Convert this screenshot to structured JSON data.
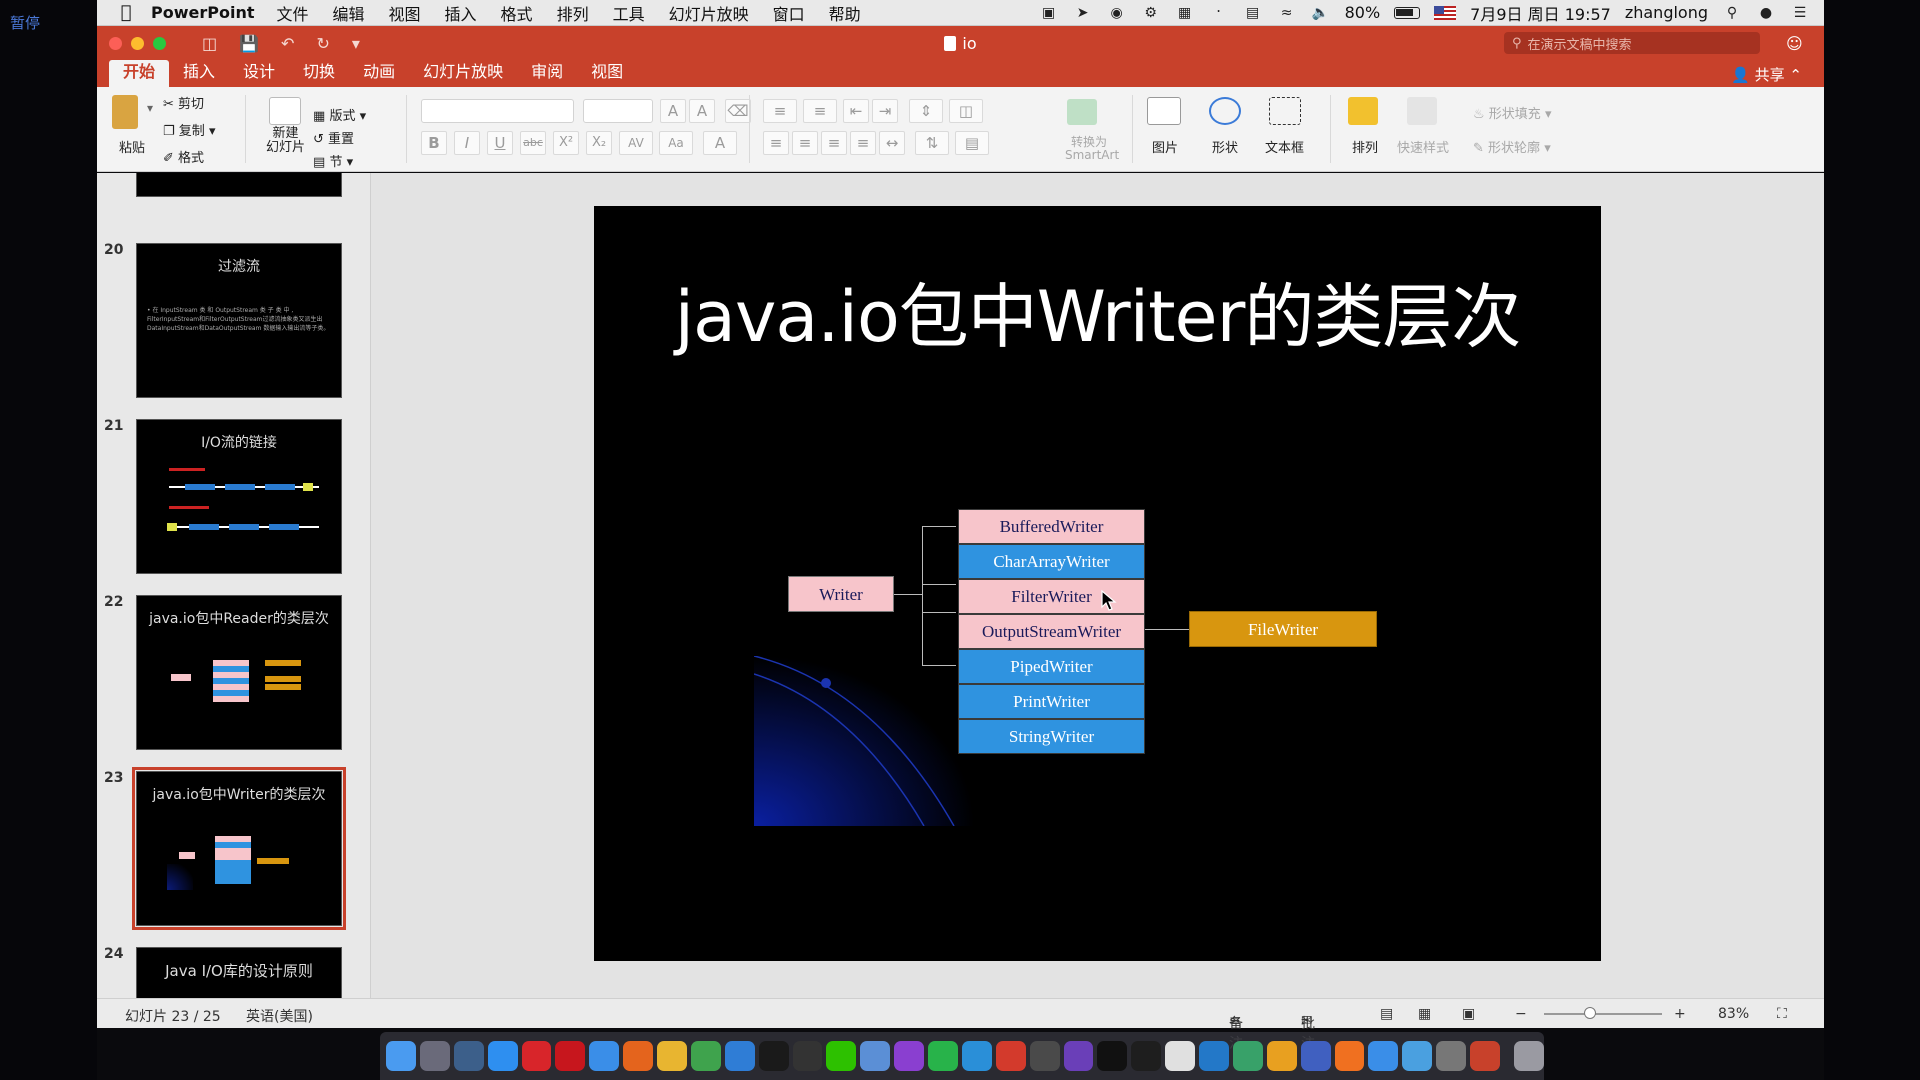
{
  "desktop": {
    "pause_label": "暂停"
  },
  "menubar": {
    "app": "PowerPoint",
    "items": [
      "文件",
      "编辑",
      "视图",
      "插入",
      "格式",
      "排列",
      "工具",
      "幻灯片放映",
      "窗口",
      "帮助"
    ],
    "battery": "80%",
    "datetime": "7月9日 周日 19:57",
    "user": "zhanglong"
  },
  "window": {
    "title": "io",
    "search_placeholder": "在演示文稿中搜索"
  },
  "ribbon_tabs": [
    "开始",
    "插入",
    "设计",
    "切换",
    "动画",
    "幻灯片放映",
    "审阅",
    "视图"
  ],
  "share_label": "共享",
  "ribbon": {
    "paste": "粘贴",
    "cut": "剪切",
    "copy": "复制",
    "format": "格式",
    "new_slide": "新建\n幻灯片",
    "layout": "版式",
    "reset": "重置",
    "section": "节",
    "convert_smartart_1": "转换为",
    "convert_smartart_2": "SmartArt",
    "picture": "图片",
    "shape": "形状",
    "textbox": "文本框",
    "arrange": "排列",
    "quick_styles": "快速样式",
    "shape_fill": "形状填充",
    "shape_outline": "形状轮廓"
  },
  "thumbnails": [
    {
      "num": "20",
      "title": "过滤流",
      "body": "• 在 InputStream 类 和 OutputStream 类 子 类 中 , FilterInputStream和FilterOutputStream过滤流抽象类又派生出DataInputStream和DataOutputStream 数据输入输出流等子类。"
    },
    {
      "num": "21",
      "title": "I/O流的链接"
    },
    {
      "num": "22",
      "title": "java.io包中Reader的类层次"
    },
    {
      "num": "23",
      "title": "java.io包中Writer的类层次"
    },
    {
      "num": "24",
      "title": "Java I/O库的设计原则"
    }
  ],
  "slide": {
    "title": "java.io包中Writer的类层次",
    "base_class": "Writer",
    "subclasses": [
      "BufferedWriter",
      "CharArrayWriter",
      "FilterWriter",
      "OutputStreamWriter",
      "PipedWriter",
      "PrintWriter",
      "StringWriter"
    ],
    "subclass_colors": [
      "pink",
      "blue",
      "pink",
      "pink",
      "blue",
      "blue",
      "blue"
    ],
    "derived_class": "FileWriter"
  },
  "statusbar": {
    "slide_counter": "幻灯片 23 / 25",
    "language": "英语(美国)",
    "notes": "备注",
    "comments": "批注",
    "zoom": "83%"
  },
  "colors": {
    "accent": "#c8412b",
    "pink_box": "#f7c5cb",
    "blue_box": "#2f93e0",
    "orange_box": "#d8960f"
  }
}
